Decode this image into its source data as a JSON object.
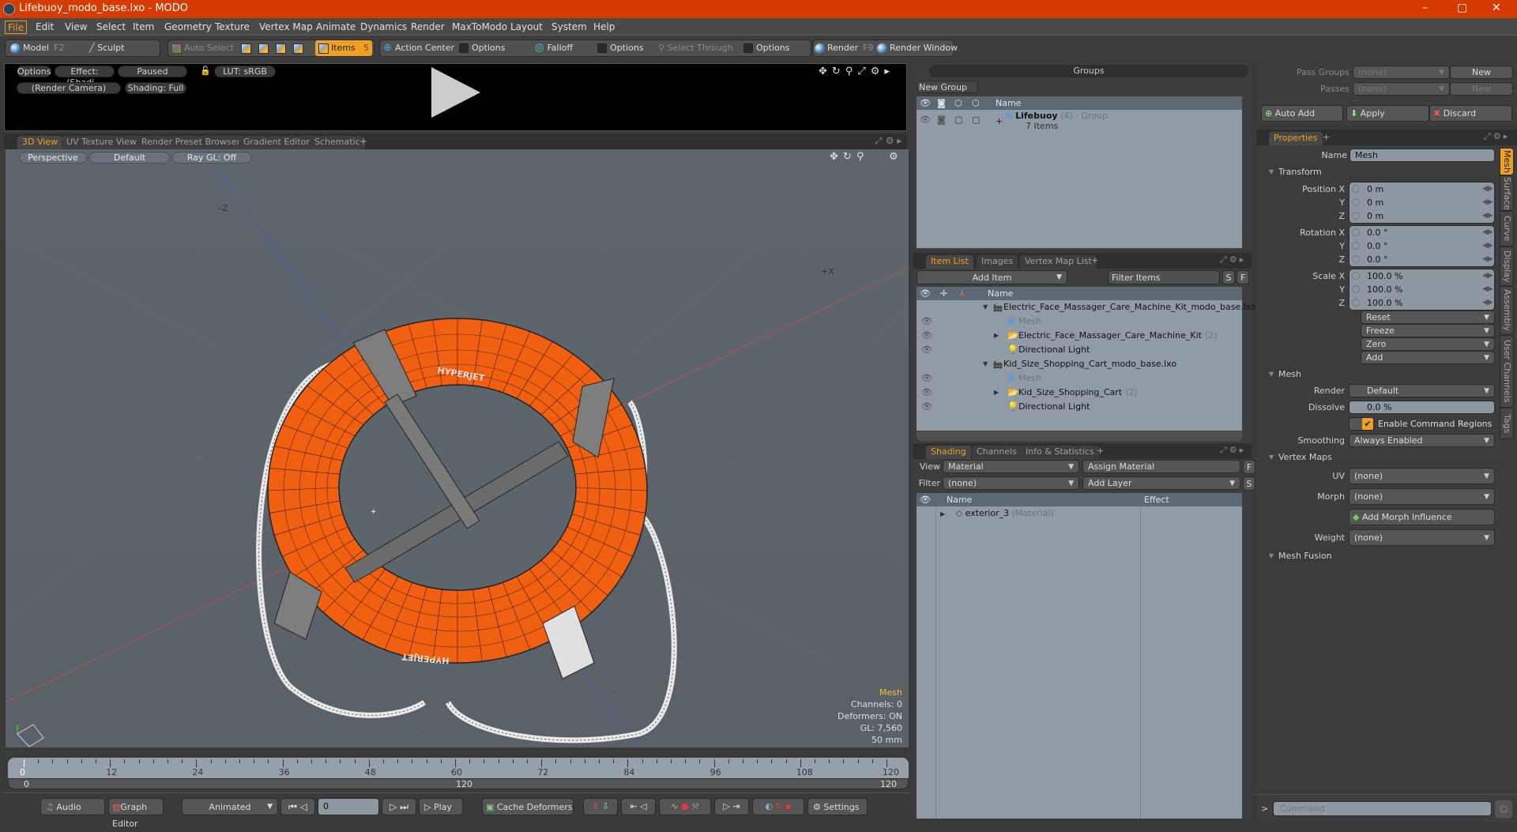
{
  "window": {
    "title": "Lifebuoy_modo_base.lxo - MODO",
    "minimize": "–",
    "maximize": "▢",
    "close": "✕"
  },
  "menu": [
    "File",
    "Edit",
    "View",
    "Select",
    "Item",
    "Geometry",
    "Texture",
    "Vertex Map",
    "Animate",
    "Dynamics",
    "Render",
    "MaxToModo",
    "Layout",
    "System",
    "Help"
  ],
  "toolbar": {
    "model": "Model",
    "model_key": "F2",
    "sculpt": "Sculpt",
    "auto_select": "Auto Select",
    "items": "Items",
    "items_key": "5",
    "action_center": "Action Center",
    "options1": "Options",
    "falloff": "Falloff",
    "options2": "Options",
    "select_through": "Select Through",
    "options3": "Options",
    "render": "Render",
    "render_key": "F9",
    "render_window": "Render Window"
  },
  "preview": {
    "options": "Options",
    "effect": "Effect: (Shadi...",
    "paused": "Paused",
    "lut": "LUT: sRGB",
    "camera": "(Render Camera)",
    "shading": "Shading: Full"
  },
  "viewport_tabs": [
    "3D View",
    "UV Texture View",
    "Render Preset Browser",
    "Gradient Editor",
    "Schematic",
    "+"
  ],
  "viewport": {
    "perspective": "Perspective",
    "default": "Default",
    "raygl": "Ray GL: Off",
    "axis_neg_z": "-Z",
    "axis_pos_x": "+X",
    "info": {
      "title": "Mesh",
      "channels": "Channels: 0",
      "deformers": "Deformers: ON",
      "gl": "GL: 7,560",
      "focal": "50 mm"
    },
    "accent": "#f0c040"
  },
  "timeline": {
    "ticks": [
      "0",
      "12",
      "24",
      "36",
      "48",
      "60",
      "72",
      "84",
      "96",
      "108",
      "120"
    ],
    "range_start": "0",
    "range_mid": "120",
    "range_end": "120"
  },
  "transport": {
    "audio": "Audio",
    "graph_editor": "Graph Editor",
    "animated": "Animated",
    "frame": "0",
    "play": "Play",
    "cache_deformers": "Cache Deformers",
    "settings": "Settings"
  },
  "groups": {
    "title": "Groups",
    "new_group": "New Group",
    "col_name": "Name",
    "row": {
      "name": "Lifebuoy",
      "count": "(4)",
      "type": ": Group",
      "items": "7 Items"
    }
  },
  "item_list": {
    "tabs": [
      "Item List",
      "Images",
      "Vertex Map List",
      "+"
    ],
    "add_item": "Add Item",
    "filter": "Filter Items",
    "s": "S",
    "f": "F",
    "col_name": "Name",
    "rows": [
      {
        "name": "Electric_Face_Massager_Care_Machine_Kit_modo_base.lxo*",
        "type": "scene",
        "indent": 0
      },
      {
        "name": "Mesh",
        "type": "mesh",
        "indent": 1
      },
      {
        "name": "Electric_Face_Massager_Care_Machine_Kit",
        "count": "(2)",
        "type": "group",
        "indent": 1
      },
      {
        "name": "Directional Light",
        "type": "light",
        "indent": 1
      },
      {
        "name": "Kid_Size_Shopping_Cart_modo_base.lxo",
        "type": "scene",
        "indent": 0
      },
      {
        "name": "Mesh",
        "type": "mesh",
        "indent": 1
      },
      {
        "name": "Kid_Size_Shopping_Cart",
        "count": "(2)",
        "type": "group",
        "indent": 1
      },
      {
        "name": "Directional Light",
        "type": "light",
        "indent": 1
      }
    ]
  },
  "shading": {
    "tabs": [
      "Shading",
      "Channels",
      "Info & Statistics",
      "+"
    ],
    "view_label": "View",
    "view_value": "Material",
    "assign": "Assign Material",
    "f": "F",
    "filter_label": "Filter",
    "filter_value": "(none)",
    "add_layer": "Add Layer",
    "s": "S",
    "col_name": "Name",
    "col_effect": "Effect",
    "row": {
      "name": "exterior_3",
      "type": "(Material)"
    }
  },
  "pass": {
    "groups_label": "Pass Groups",
    "groups_value": "(none)",
    "new1": "New",
    "passes_label": "Passes",
    "passes_value": "(none)",
    "new2": "New",
    "auto_add": "Auto Add",
    "apply": "Apply",
    "discard": "Discard"
  },
  "properties": {
    "tab": "Properties",
    "name_label": "Name",
    "name_value": "Mesh",
    "transform": "Transform",
    "position": {
      "label": "Position X",
      "x": "0 m",
      "y": "0 m",
      "z": "0 m"
    },
    "rotation": {
      "label": "Rotation X",
      "x": "0.0 °",
      "y": "0.0 °",
      "z": "0.0 °"
    },
    "scale": {
      "label": "Scale X",
      "x": "100.0 %",
      "y": "100.0 %",
      "z": "100.0 %"
    },
    "axis_y": "Y",
    "axis_z": "Z",
    "actions": [
      "Reset",
      "Freeze",
      "Zero",
      "Add"
    ],
    "mesh": "Mesh",
    "render_label": "Render",
    "render_value": "Default",
    "dissolve_label": "Dissolve",
    "dissolve_value": "0.0 %",
    "command_regions": "Enable Command Regions",
    "smoothing_label": "Smoothing",
    "smoothing_value": "Always Enabled",
    "vertex_maps": "Vertex Maps",
    "uv_label": "UV",
    "uv_value": "(none)",
    "morph_label": "Morph",
    "morph_value": "(none)",
    "add_morph": "Add Morph Influence",
    "weight_label": "Weight",
    "weight_value": "(none)",
    "mesh_fusion": "Mesh Fusion",
    "side_tabs": [
      "Mesh",
      "Surface",
      "Curve",
      "Display",
      "Assembly",
      "User Channels",
      "Tags"
    ]
  },
  "command": {
    "prompt": ">",
    "placeholder": "Command"
  }
}
